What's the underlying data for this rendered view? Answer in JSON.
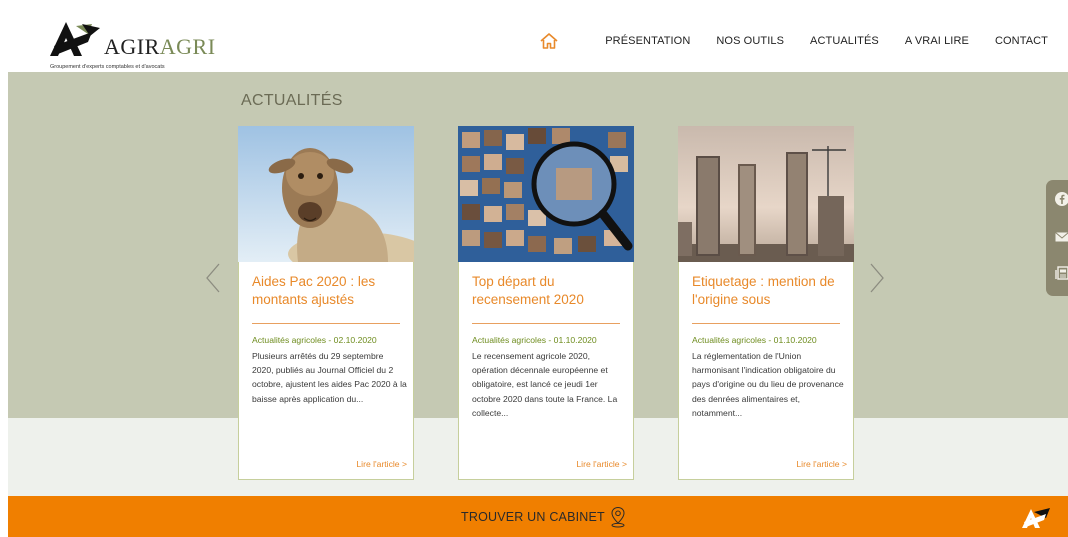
{
  "header": {
    "brand_black": "AGIR",
    "brand_green": "AGRI",
    "tagline": "Groupement d'experts comptables et d'avocats",
    "nav": [
      "PRÉSENTATION",
      "NOS OUTILS",
      "ACTUALITÉS",
      "A VRAI LIRE",
      "CONTACT"
    ],
    "home_icon": "home-icon"
  },
  "section": {
    "title": "ACTUALITÉS"
  },
  "cards": [
    {
      "title": "Aides Pac 2020 : les montants ajustés",
      "meta": "Actualités agricoles - 02.10.2020",
      "excerpt": "Plusieurs arrêtés du 29 septembre 2020, publiés au Journal Officiel du 2 octobre, ajustent les aides Pac 2020 à la baisse après application du...",
      "more": "Lire l'article >"
    },
    {
      "title": "Top départ du recensement 2020",
      "meta": "Actualités agricoles - 01.10.2020",
      "excerpt": "Le recensement agricole 2020, opération décennale européenne et obligatoire, est lancé ce jeudi 1er octobre 2020 dans toute la France. La collecte...",
      "more": "Lire l'article >"
    },
    {
      "title": "Etiquetage : mention de l'origine sous",
      "meta": "Actualités agricoles - 01.10.2020",
      "excerpt": "La réglementation de l'Union harmonisant l'indication obligatoire du pays d'origine ou du lieu de provenance des denrées alimentaires et, notamment...",
      "more": "Lire l'article >"
    }
  ],
  "footer": {
    "find_label": "TROUVER UN CABINET"
  },
  "colors": {
    "accent": "#f07f00",
    "olive": "#7a8a57",
    "band": "#c5c9b3",
    "title_orange": "#e8892a",
    "meta_green": "#6e8c1e"
  }
}
